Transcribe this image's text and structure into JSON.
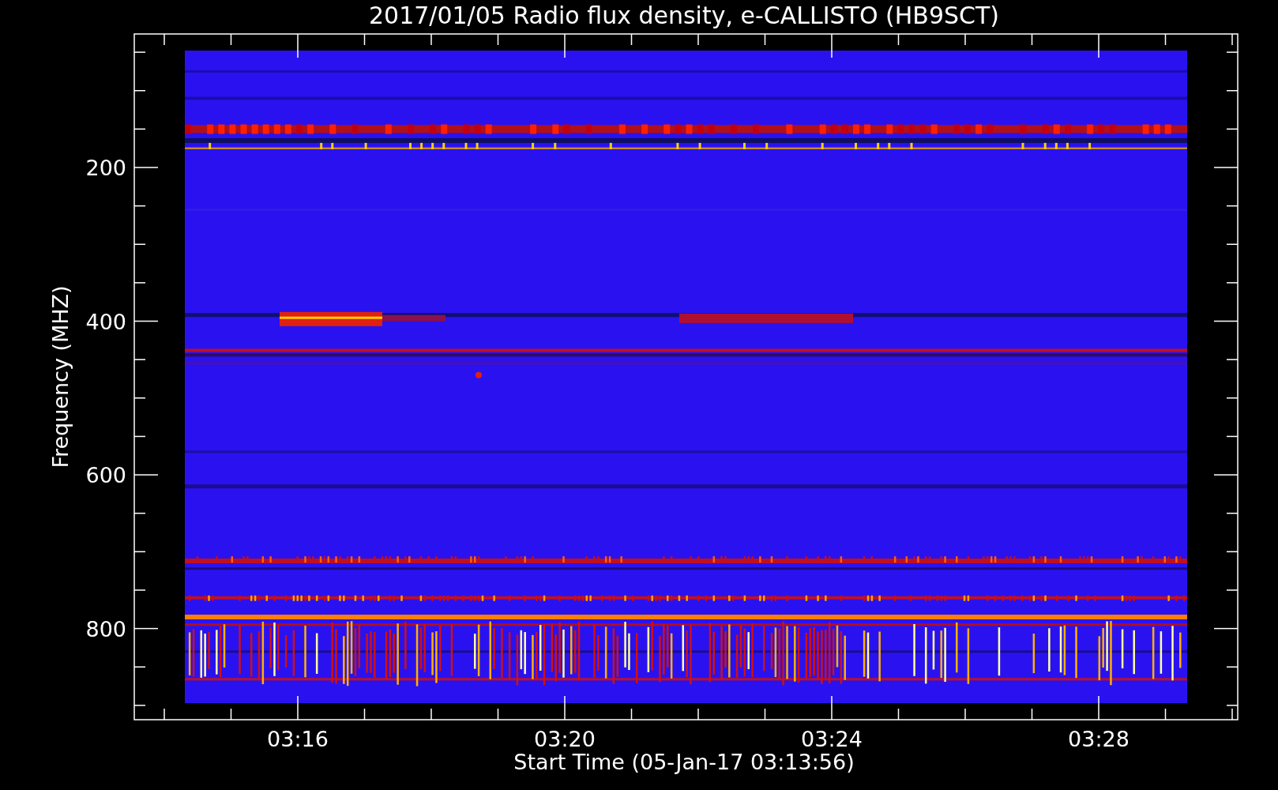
{
  "title": "2017/01/05  Radio flux density, e-CALLISTO (HB9SCT)",
  "ylabel": "Frequency (MHZ)",
  "xlabel": "Start Time (05-Jan-17 03:13:56)",
  "yticks": [
    "200",
    "400",
    "600",
    "800"
  ],
  "xticks": [
    "03:16",
    "03:20",
    "03:24",
    "03:28"
  ]
}
